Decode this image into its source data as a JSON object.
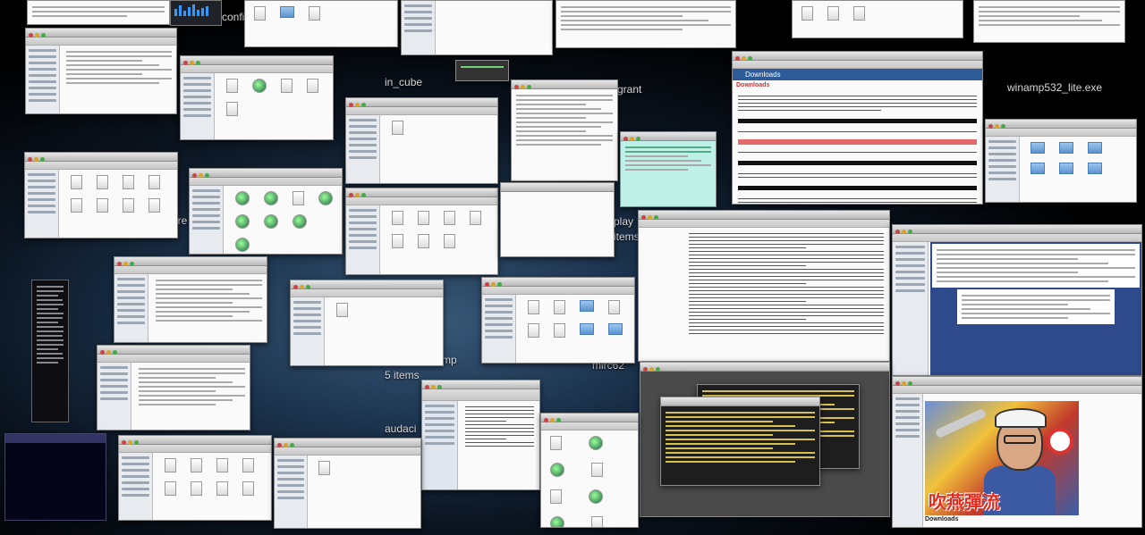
{
  "desktop_labels": {
    "config": "config",
    "in_cube": "in_cube",
    "grant": "grant",
    "winamp": "winamp532_lite.exe",
    "play": "play",
    "items_tr": "items",
    "mp": "mp",
    "five_items": "5 items",
    "mirc": "mirc62",
    "audac": "audaci",
    "ire": "ire"
  },
  "browser": {
    "site_title": "Downloads",
    "heading": "Downloads"
  },
  "browser_bottom": {
    "heading": "Downloads",
    "poster_caption": "吹燕彈流"
  },
  "colors": {
    "wallpaper_center": "#3a5a7a",
    "accent_blue": "#2c5b97",
    "alert_red": "#e46a6a"
  },
  "icons": [
    "folder-icon",
    "document-icon",
    "app-icon",
    "earth-icon"
  ]
}
